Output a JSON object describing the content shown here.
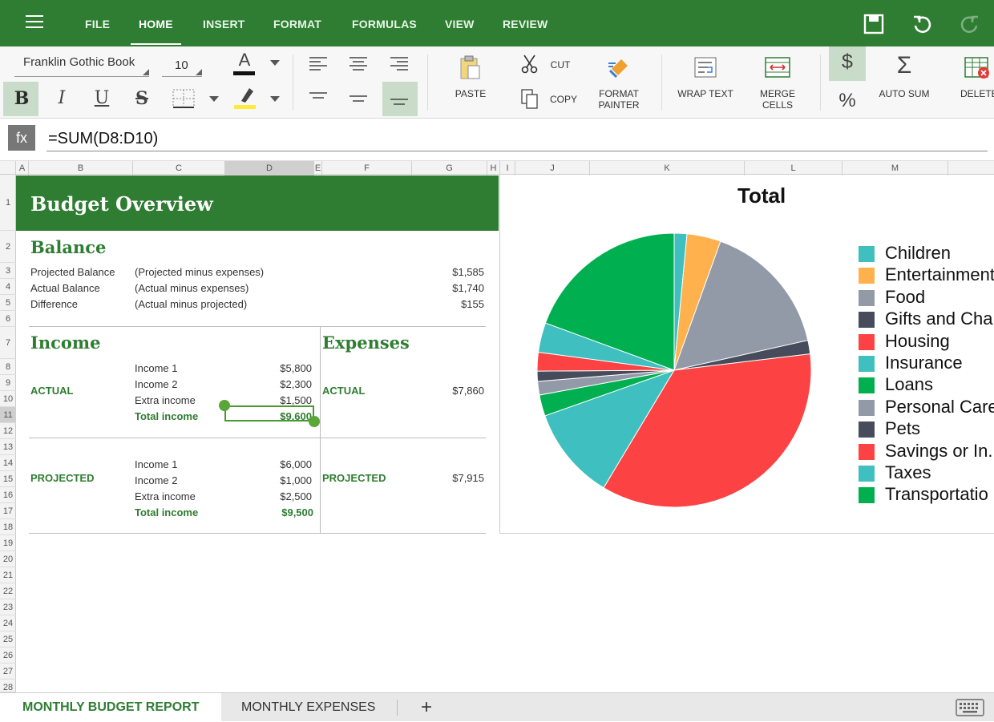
{
  "app": {
    "menu_tabs": [
      "FILE",
      "HOME",
      "INSERT",
      "FORMAT",
      "FORMULAS",
      "VIEW",
      "REVIEW"
    ],
    "active_tab": "HOME",
    "icons": [
      "hamburger-menu-icon",
      "save-icon",
      "undo-icon",
      "redo-icon"
    ]
  },
  "ribbon": {
    "font_name": "Franklin Gothic Book",
    "font_size": "10",
    "bold": "B",
    "italic": "I",
    "underline": "U",
    "strike": "S",
    "font_color_letter": "A",
    "paste": "PASTE",
    "cut": "CUT",
    "copy": "COPY",
    "format_painter_1": "FORMAT",
    "format_painter_2": "PAINTER",
    "wrap_text": "WRAP TEXT",
    "merge_1": "MERGE",
    "merge_2": "CELLS",
    "currency": "$",
    "percent": "%",
    "auto_sum": "AUTO SUM",
    "sigma": "Σ",
    "delete": "DELETE",
    "accent": "#2e7d32"
  },
  "formula_bar": {
    "fx": "fx",
    "formula": "=SUM(D8:D10)"
  },
  "columns": [
    "A",
    "B",
    "C",
    "D",
    "E",
    "F",
    "G",
    "H",
    "I",
    "J",
    "K",
    "L",
    "M"
  ],
  "rows": [
    "1",
    "2",
    "3",
    "4",
    "5",
    "6",
    "7",
    "8",
    "9",
    "10",
    "11",
    "12",
    "13",
    "14",
    "15",
    "16",
    "17",
    "18",
    "19",
    "20",
    "21",
    "22",
    "23",
    "24",
    "25",
    "26",
    "27",
    "28"
  ],
  "selected_column": "D",
  "selected_row": "11",
  "sheet": {
    "title": "Budget Overview",
    "balance": {
      "heading": "Balance",
      "rows": [
        {
          "label": "Projected Balance",
          "note": "(Projected  minus expenses)",
          "value": "$1,585"
        },
        {
          "label": "Actual Balance",
          "note": "(Actual  minus expenses)",
          "value": "$1,740"
        },
        {
          "label": "Difference",
          "note": "(Actual minus projected)",
          "value": "$155"
        }
      ]
    },
    "income": {
      "heading": "Income",
      "actual_label": "ACTUAL",
      "actual": [
        {
          "label": "Income 1",
          "value": "$5,800"
        },
        {
          "label": "Income 2",
          "value": "$2,300"
        },
        {
          "label": "Extra income",
          "value": "$1,500"
        },
        {
          "label": "Total income",
          "value": "$9,600"
        }
      ],
      "projected_label": "PROJECTED",
      "projected": [
        {
          "label": "Income 1",
          "value": "$6,000"
        },
        {
          "label": "Income 2",
          "value": "$1,000"
        },
        {
          "label": "Extra income",
          "value": "$2,500"
        },
        {
          "label": "Total income",
          "value": "$9,500"
        }
      ]
    },
    "expenses": {
      "heading": "Expenses",
      "actual_label": "ACTUAL",
      "actual_value": "$7,860",
      "projected_label": "PROJECTED",
      "projected_value": "$7,915"
    }
  },
  "chart_data": {
    "type": "pie",
    "title": "Total",
    "legend_position": "right",
    "categories": [
      "Children",
      "Entertainment",
      "Food",
      "Gifts and Charity",
      "Housing",
      "Insurance",
      "Loans",
      "Personal Care",
      "Pets",
      "Savings or In...",
      "Taxes",
      "Transportation"
    ],
    "legend_labels": [
      "Children",
      "Entertainment",
      "Food",
      "Gifts and Cha",
      "Housing",
      "Insurance",
      "Loans",
      "Personal Care",
      "Pets",
      "Savings or In.",
      "Taxes",
      "Transportatio"
    ],
    "values": [
      1.5,
      4.0,
      16.0,
      1.6,
      35.5,
      11.0,
      2.5,
      1.6,
      1.2,
      2.2,
      3.5,
      19.4
    ],
    "colors": [
      "#3fbfbf",
      "#ffb14e",
      "#929aa8",
      "#474c5c",
      "#fc4242",
      "#3fbfbf",
      "#00b050",
      "#929aa8",
      "#474c5c",
      "#fc4242",
      "#3fbfbf",
      "#00b050"
    ]
  },
  "sheet_tabs": [
    "MONTHLY BUDGET REPORT",
    "MONTHLY EXPENSES"
  ],
  "add_sheet": "+"
}
